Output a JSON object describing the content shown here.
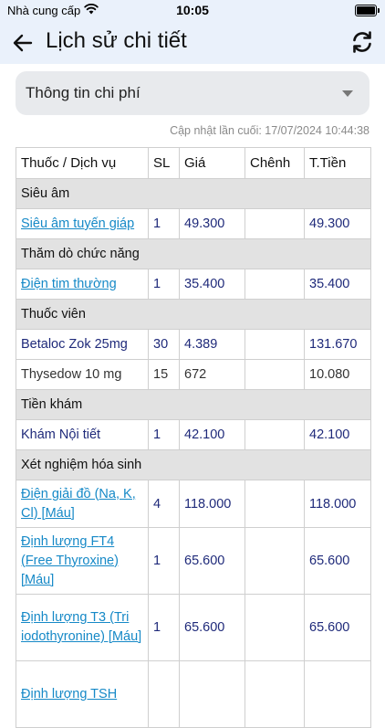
{
  "status_bar": {
    "carrier": "Nhà cung cấp",
    "time": "10:05"
  },
  "header": {
    "title": "Lịch sử chi tiết"
  },
  "select": {
    "label": "Thông tin chi phí"
  },
  "updated_text": "Cập nhật lần cuối: 17/07/2024 10:44:38",
  "table": {
    "headers": [
      "Thuốc / Dịch vụ",
      "SL",
      "Giá",
      "Chênh",
      "T.Tiền"
    ],
    "rows": [
      {
        "type": "group",
        "label": "Siêu âm"
      },
      {
        "type": "item",
        "name": "Siêu âm tuyến giáp",
        "qty": "1",
        "price": "49.300",
        "diff": "",
        "total": "49.300"
      },
      {
        "type": "group",
        "label": "Thăm dò chức năng"
      },
      {
        "type": "item",
        "name": "Điện tim thường",
        "qty": "1",
        "price": "35.400",
        "diff": "",
        "total": "35.400"
      },
      {
        "type": "group",
        "label": "Thuốc viên"
      },
      {
        "type": "item",
        "name": "Betaloc Zok 25mg",
        "qty": "30",
        "price": "4.389",
        "diff": "",
        "total": "131.670"
      },
      {
        "type": "item",
        "name": "Thysedow 10 mg",
        "qty": "15",
        "price": "672",
        "diff": "",
        "total": "10.080"
      },
      {
        "type": "group",
        "label": "Tiền khám"
      },
      {
        "type": "item",
        "name": "Khám Nội tiết",
        "qty": "1",
        "price": "42.100",
        "diff": "",
        "total": "42.100"
      },
      {
        "type": "group",
        "label": "Xét nghiệm hóa sinh"
      },
      {
        "type": "item",
        "name": "Điện giải đồ (Na, K, Cl) [Máu]",
        "qty": "4",
        "price": "118.000",
        "diff": "",
        "total": "118.000"
      },
      {
        "type": "item",
        "name": "Định lượng FT4 (Free Thyroxine) [Máu]",
        "qty": "1",
        "price": "65.600",
        "diff": "",
        "total": "65.600"
      },
      {
        "type": "item",
        "name": "Định lượng T3 (Tri iodothyronine) [Máu]",
        "qty": "1",
        "price": "65.600",
        "diff": "",
        "total": "65.600"
      },
      {
        "type": "item",
        "name": "Định lượng TSH",
        "qty": "",
        "price": "",
        "diff": "",
        "total": ""
      }
    ]
  }
}
